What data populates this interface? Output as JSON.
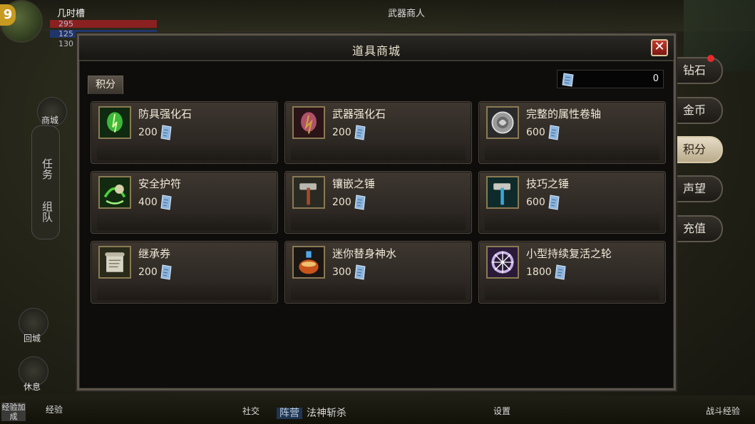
{
  "hud": {
    "player_name": "几时槽",
    "level": "9",
    "hp": "295",
    "mp": "125",
    "exp_stat": "130",
    "npc_name": "武器商人",
    "left_tabs": [
      "任务",
      "组队"
    ],
    "left_buttons": [
      "商城",
      "回城",
      "休息"
    ],
    "bottom_left": "经验加成",
    "bottom_exp_label": "经验",
    "chat_channel": "阵营",
    "chat_text": "法神斩杀",
    "social_label": "社交",
    "settings_label": "设置",
    "auto_battle_label": "战斗经验"
  },
  "side_tabs": [
    {
      "label": "钻石",
      "active": false,
      "notify": true
    },
    {
      "label": "金币",
      "active": false,
      "notify": false
    },
    {
      "label": "积分",
      "active": true,
      "notify": false
    },
    {
      "label": "声望",
      "active": false,
      "notify": false
    },
    {
      "label": "充值",
      "active": false,
      "notify": false
    }
  ],
  "dialog": {
    "title": "道具商城",
    "close_label": "✕",
    "category_tab": "积分",
    "balance": "0"
  },
  "items": [
    {
      "name": "防具强化石",
      "price": "200",
      "icon": "armor-stone-icon",
      "color": "#3cb83a"
    },
    {
      "name": "武器强化石",
      "price": "200",
      "icon": "weapon-stone-icon",
      "color": "#c9a23a"
    },
    {
      "name": "完整的属性卷轴",
      "price": "600",
      "icon": "attribute-scroll-icon",
      "color": "#9a9a9a"
    },
    {
      "name": "安全护符",
      "price": "400",
      "icon": "safety-amulet-icon",
      "color": "#4ecf3c"
    },
    {
      "name": "镶嵌之锤",
      "price": "200",
      "icon": "inlay-hammer-icon",
      "color": "#a44a2a"
    },
    {
      "name": "技巧之锤",
      "price": "600",
      "icon": "skill-hammer-icon",
      "color": "#3aa6d9"
    },
    {
      "name": "继承券",
      "price": "200",
      "icon": "inherit-ticket-icon",
      "color": "#d8d4c4"
    },
    {
      "name": "迷你替身神水",
      "price": "300",
      "icon": "mini-potion-icon",
      "color": "#c8541c"
    },
    {
      "name": "小型持续复活之轮",
      "price": "1800",
      "icon": "revive-wheel-icon",
      "color": "#c8b4e8"
    }
  ]
}
